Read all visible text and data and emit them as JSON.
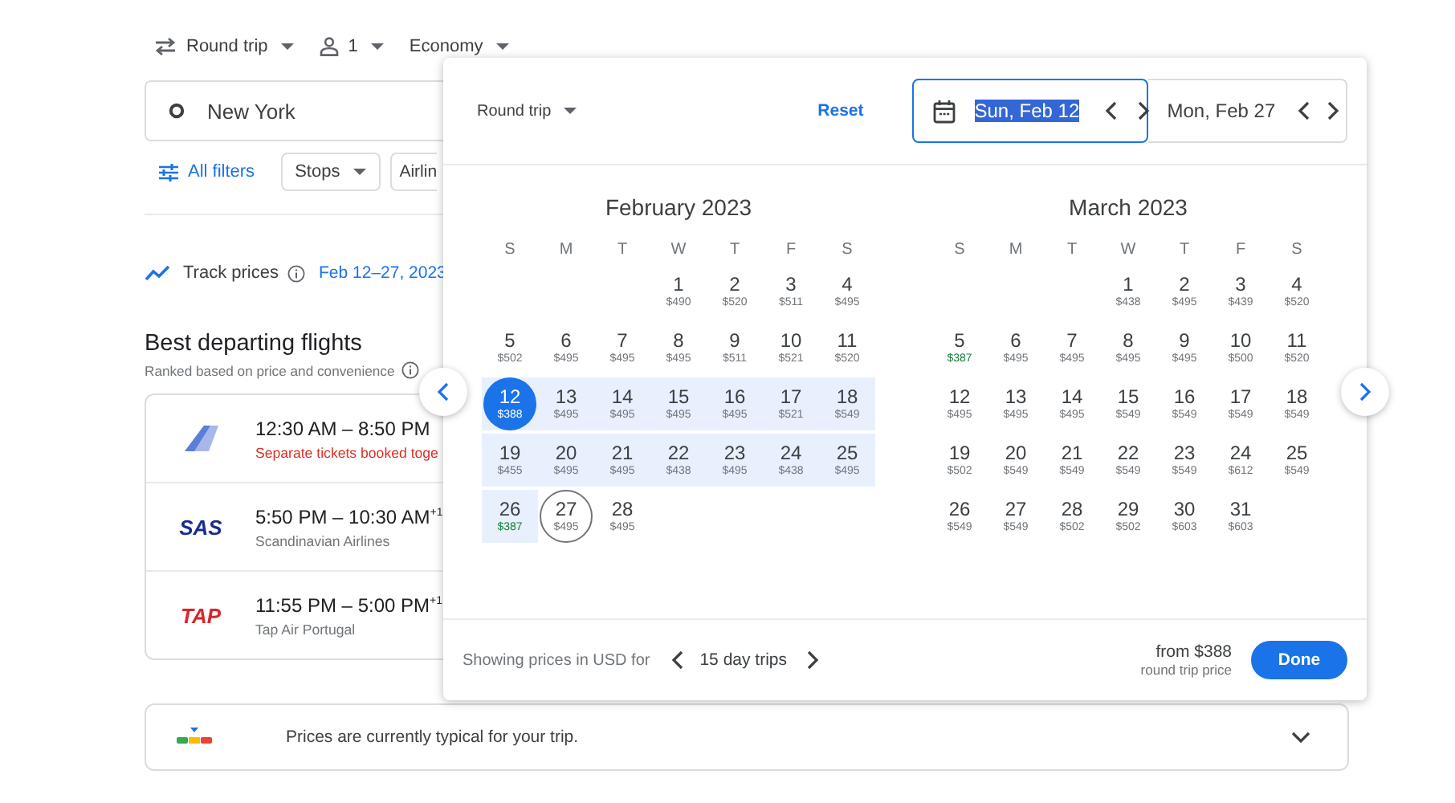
{
  "top_bar": [
    {
      "kind": "trip",
      "label": "Round trip"
    },
    {
      "kind": "passengers",
      "label": "1"
    },
    {
      "kind": "cabin",
      "label": "Economy"
    }
  ],
  "origin_field": {
    "value": "New York"
  },
  "filters": {
    "all_filters": "All filters",
    "chips": [
      "Stops",
      "Airlin"
    ]
  },
  "track_prices": {
    "label": "Track prices",
    "dates": "Feb 12–27, 2023"
  },
  "results": {
    "title": "Best departing flights",
    "subtitle": "Ranked based on price and convenience",
    "flights": [
      {
        "logo": {
          "kind": "fin"
        },
        "times": "12:30 AM – 8:50 PM",
        "note": "Separate tickets booked toge",
        "warning": true
      },
      {
        "logo": {
          "kind": "wordmark",
          "text": "SAS",
          "color": "#1a2c8c"
        },
        "times": "5:50 PM – 10:30 AM$^{+1}$",
        "note": "Scandinavian Airlines",
        "warning": false
      },
      {
        "logo": {
          "kind": "wordmark",
          "text": "TAP",
          "color": "#d9262a"
        },
        "times": "11:55 PM – 5:00 PM$^{+1}$",
        "note": "Tap Air Portugal",
        "warning": false
      }
    ]
  },
  "price_insight": {
    "text": "Prices are currently typical for your trip."
  },
  "date_picker": {
    "trip_type": "Round trip",
    "reset": "Reset",
    "departure": {
      "value": "Sun, Feb 12",
      "focused": true
    },
    "return": {
      "value": "Mon, Feb 27",
      "focused": false
    },
    "months": [
      {
        "title": "February 2023",
        "weekdays": [
          "S",
          "M",
          "T",
          "W",
          "T",
          "F",
          "S"
        ],
        "weeks": [
          [
            {
              "day": "1",
              "price": "$490",
              "cheap": false,
              "in_range": false,
              "selected": false,
              "outlined": false
            },
            {
              "day": "2",
              "price": "$520",
              "cheap": false,
              "in_range": false,
              "selected": false,
              "outlined": false
            },
            {
              "day": "3",
              "price": "$511",
              "cheap": false,
              "in_range": false,
              "selected": false,
              "outlined": false
            },
            {
              "day": "4",
              "price": "$495",
              "cheap": false,
              "in_range": false,
              "selected": false,
              "outlined": false
            }
          ],
          [
            {
              "day": "5",
              "price": "$502",
              "cheap": false,
              "in_range": false,
              "selected": false,
              "outlined": false
            },
            {
              "day": "6",
              "price": "$495",
              "cheap": false,
              "in_range": false,
              "selected": false,
              "outlined": false
            },
            {
              "day": "7",
              "price": "$495",
              "cheap": false,
              "in_range": false,
              "selected": false,
              "outlined": false
            },
            {
              "day": "8",
              "price": "$495",
              "cheap": false,
              "in_range": false,
              "selected": false,
              "outlined": false
            },
            {
              "day": "9",
              "price": "$511",
              "cheap": false,
              "in_range": false,
              "selected": false,
              "outlined": false
            },
            {
              "day": "10",
              "price": "$521",
              "cheap": false,
              "in_range": false,
              "selected": false,
              "outlined": false
            },
            {
              "day": "11",
              "price": "$520",
              "cheap": false,
              "in_range": false,
              "selected": false,
              "outlined": false
            }
          ],
          [
            {
              "day": "12",
              "price": "$388",
              "cheap": false,
              "in_range": true,
              "selected": true,
              "outlined": false
            },
            {
              "day": "13",
              "price": "$495",
              "cheap": false,
              "in_range": true,
              "selected": false,
              "outlined": false
            },
            {
              "day": "14",
              "price": "$495",
              "cheap": false,
              "in_range": true,
              "selected": false,
              "outlined": false
            },
            {
              "day": "15",
              "price": "$495",
              "cheap": false,
              "in_range": true,
              "selected": false,
              "outlined": false
            },
            {
              "day": "16",
              "price": "$495",
              "cheap": false,
              "in_range": true,
              "selected": false,
              "outlined": false
            },
            {
              "day": "17",
              "price": "$521",
              "cheap": false,
              "in_range": true,
              "selected": false,
              "outlined": false
            },
            {
              "day": "18",
              "price": "$549",
              "cheap": false,
              "in_range": true,
              "selected": false,
              "outlined": false
            }
          ],
          [
            {
              "day": "19",
              "price": "$455",
              "cheap": false,
              "in_range": true,
              "selected": false,
              "outlined": false
            },
            {
              "day": "20",
              "price": "$495",
              "cheap": false,
              "in_range": true,
              "selected": false,
              "outlined": false
            },
            {
              "day": "21",
              "price": "$495",
              "cheap": false,
              "in_range": true,
              "selected": false,
              "outlined": false
            },
            {
              "day": "22",
              "price": "$438",
              "cheap": false,
              "in_range": true,
              "selected": false,
              "outlined": false
            },
            {
              "day": "23",
              "price": "$495",
              "cheap": false,
              "in_range": true,
              "selected": false,
              "outlined": false
            },
            {
              "day": "24",
              "price": "$438",
              "cheap": false,
              "in_range": true,
              "selected": false,
              "outlined": false
            },
            {
              "day": "25",
              "price": "$495",
              "cheap": false,
              "in_range": true,
              "selected": false,
              "outlined": false
            }
          ],
          [
            {
              "day": "26",
              "price": "$387",
              "cheap": true,
              "in_range": true,
              "selected": false,
              "outlined": false
            },
            {
              "day": "27",
              "price": "$495",
              "cheap": false,
              "in_range": false,
              "selected": false,
              "outlined": true
            },
            {
              "day": "28",
              "price": "$495",
              "cheap": false,
              "in_range": false,
              "selected": false,
              "outlined": false
            }
          ]
        ]
      },
      {
        "title": "March 2023",
        "weekdays": [
          "S",
          "M",
          "T",
          "W",
          "T",
          "F",
          "S"
        ],
        "weeks": [
          [
            {
              "day": "1",
              "price": "$438",
              "cheap": false,
              "in_range": false,
              "selected": false,
              "outlined": false
            },
            {
              "day": "2",
              "price": "$495",
              "cheap": false,
              "in_range": false,
              "selected": false,
              "outlined": false
            },
            {
              "day": "3",
              "price": "$439",
              "cheap": false,
              "in_range": false,
              "selected": false,
              "outlined": false
            },
            {
              "day": "4",
              "price": "$520",
              "cheap": false,
              "in_range": false,
              "selected": false,
              "outlined": false
            }
          ],
          [
            {
              "day": "5",
              "price": "$387",
              "cheap": true,
              "in_range": false,
              "selected": false,
              "outlined": false
            },
            {
              "day": "6",
              "price": "$495",
              "cheap": false,
              "in_range": false,
              "selected": false,
              "outlined": false
            },
            {
              "day": "7",
              "price": "$495",
              "cheap": false,
              "in_range": false,
              "selected": false,
              "outlined": false
            },
            {
              "day": "8",
              "price": "$495",
              "cheap": false,
              "in_range": false,
              "selected": false,
              "outlined": false
            },
            {
              "day": "9",
              "price": "$495",
              "cheap": false,
              "in_range": false,
              "selected": false,
              "outlined": false
            },
            {
              "day": "10",
              "price": "$500",
              "cheap": false,
              "in_range": false,
              "selected": false,
              "outlined": false
            },
            {
              "day": "11",
              "price": "$520",
              "cheap": false,
              "in_range": false,
              "selected": false,
              "outlined": false
            }
          ],
          [
            {
              "day": "12",
              "price": "$495",
              "cheap": false,
              "in_range": false,
              "selected": false,
              "outlined": false
            },
            {
              "day": "13",
              "price": "$495",
              "cheap": false,
              "in_range": false,
              "selected": false,
              "outlined": false
            },
            {
              "day": "14",
              "price": "$495",
              "cheap": false,
              "in_range": false,
              "selected": false,
              "outlined": false
            },
            {
              "day": "15",
              "price": "$549",
              "cheap": false,
              "in_range": false,
              "selected": false,
              "outlined": false
            },
            {
              "day": "16",
              "price": "$549",
              "cheap": false,
              "in_range": false,
              "selected": false,
              "outlined": false
            },
            {
              "day": "17",
              "price": "$549",
              "cheap": false,
              "in_range": false,
              "selected": false,
              "outlined": false
            },
            {
              "day": "18",
              "price": "$549",
              "cheap": false,
              "in_range": false,
              "selected": false,
              "outlined": false
            }
          ],
          [
            {
              "day": "19",
              "price": "$502",
              "cheap": false,
              "in_range": false,
              "selected": false,
              "outlined": false
            },
            {
              "day": "20",
              "price": "$549",
              "cheap": false,
              "in_range": false,
              "selected": false,
              "outlined": false
            },
            {
              "day": "21",
              "price": "$549",
              "cheap": false,
              "in_range": false,
              "selected": false,
              "outlined": false
            },
            {
              "day": "22",
              "price": "$549",
              "cheap": false,
              "in_range": false,
              "selected": false,
              "outlined": false
            },
            {
              "day": "23",
              "price": "$549",
              "cheap": false,
              "in_range": false,
              "selected": false,
              "outlined": false
            },
            {
              "day": "24",
              "price": "$612",
              "cheap": false,
              "in_range": false,
              "selected": false,
              "outlined": false
            },
            {
              "day": "25",
              "price": "$549",
              "cheap": false,
              "in_range": false,
              "selected": false,
              "outlined": false
            }
          ],
          [
            {
              "day": "26",
              "price": "$549",
              "cheap": false,
              "in_range": false,
              "selected": false,
              "outlined": false
            },
            {
              "day": "27",
              "price": "$549",
              "cheap": false,
              "in_range": false,
              "selected": false,
              "outlined": false
            },
            {
              "day": "28",
              "price": "$502",
              "cheap": false,
              "in_range": false,
              "selected": false,
              "outlined": false
            },
            {
              "day": "29",
              "price": "$502",
              "cheap": false,
              "in_range": false,
              "selected": false,
              "outlined": false
            },
            {
              "day": "30",
              "price": "$603",
              "cheap": false,
              "in_range": false,
              "selected": false,
              "outlined": false
            },
            {
              "day": "31",
              "price": "$603",
              "cheap": false,
              "in_range": false,
              "selected": false,
              "outlined": false
            }
          ]
        ]
      }
    ],
    "footer": {
      "note": "Showing prices in USD for",
      "duration": "15 day trips",
      "from": "from $388",
      "from_note": "round trip price",
      "done": "Done"
    }
  }
}
